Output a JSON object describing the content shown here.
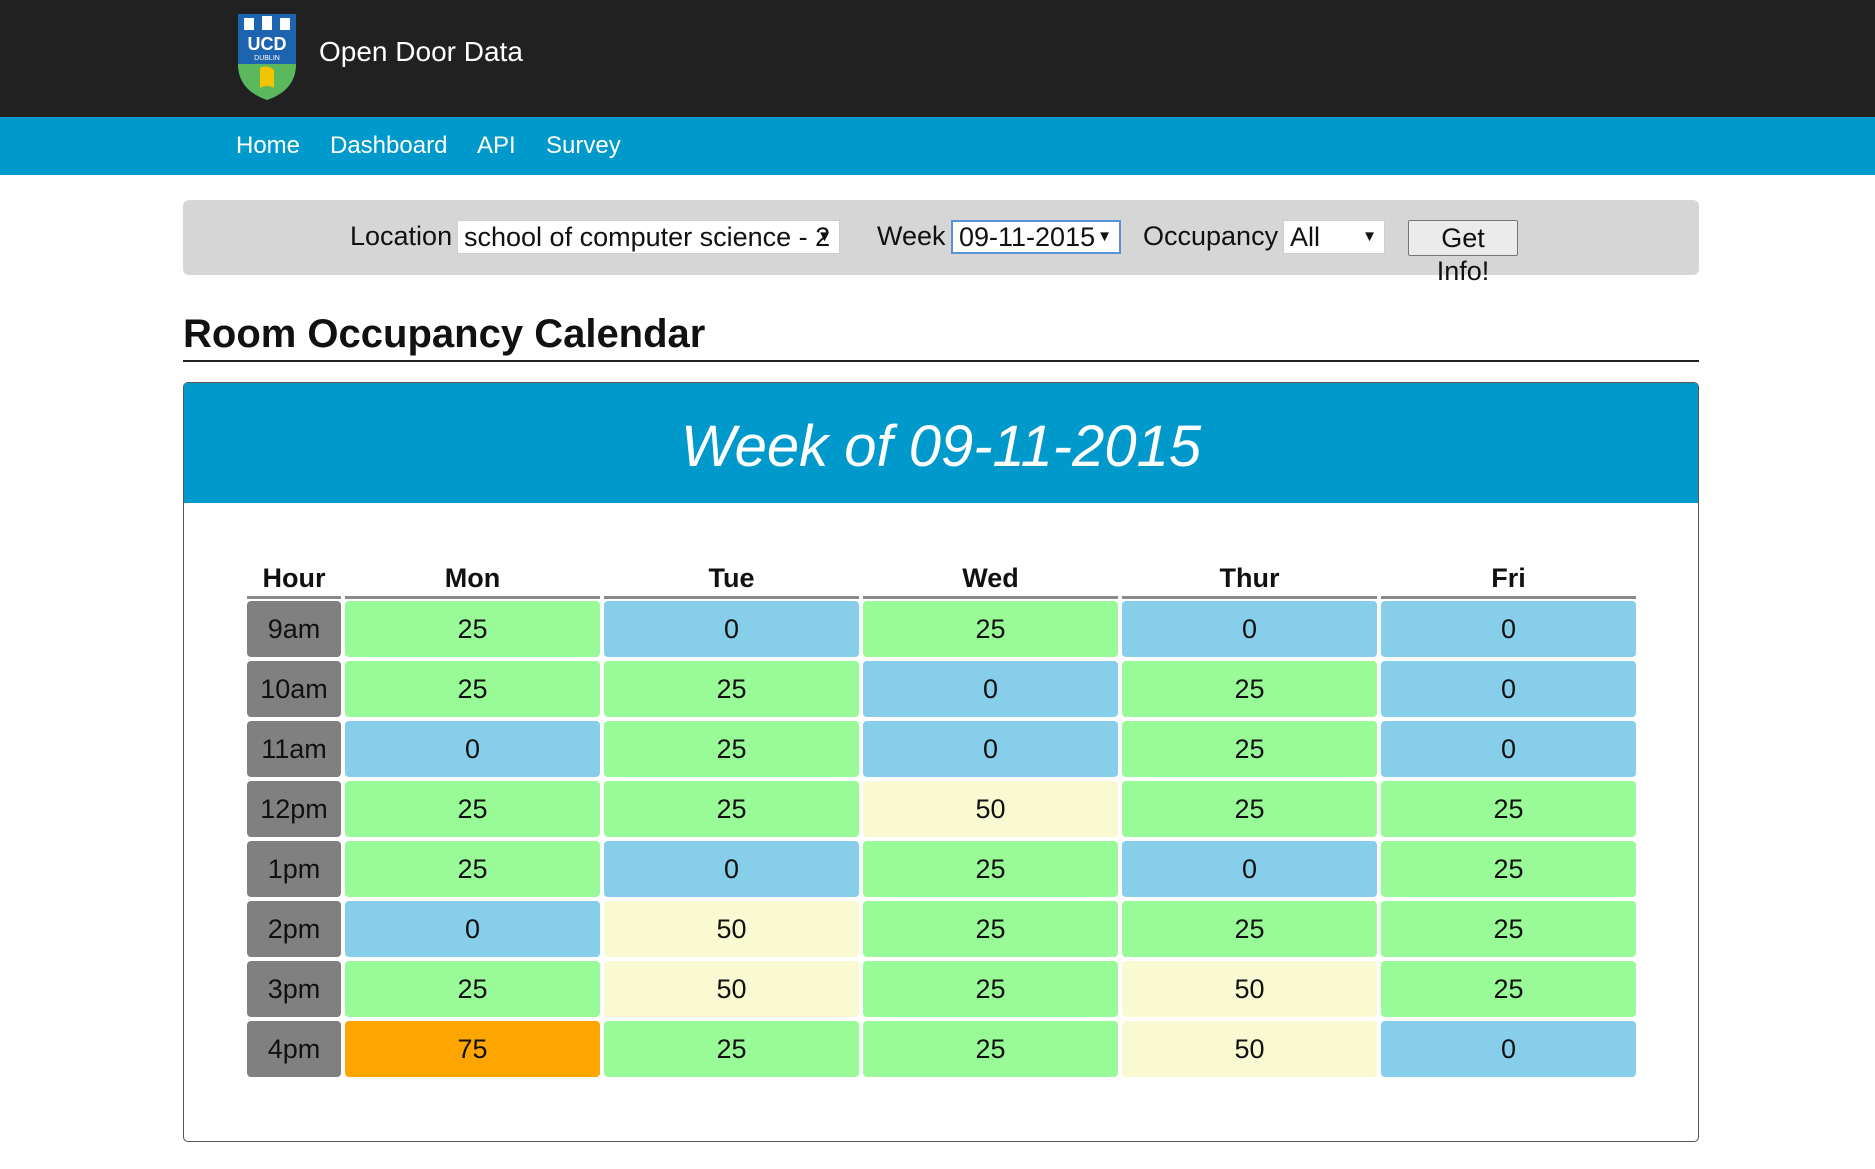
{
  "header": {
    "logo_text": "UCD",
    "logo_subtext": "DUBLIN",
    "site_title": "Open Door Data"
  },
  "nav": {
    "items": [
      "Home",
      "Dashboard",
      "API",
      "Survey"
    ]
  },
  "filters": {
    "location_label": "Location",
    "location_value": "school of computer science - 2",
    "week_label": "Week",
    "week_value": "09-11-2015",
    "occupancy_label": "Occupancy",
    "occupancy_value": "All",
    "submit_label": "Get Info!"
  },
  "page": {
    "title": "Room Occupancy Calendar"
  },
  "calendar": {
    "title": "Week of 09-11-2015",
    "hour_header": "Hour",
    "days": [
      "Mon",
      "Tue",
      "Wed",
      "Thur",
      "Fri"
    ],
    "hours": [
      "9am",
      "10am",
      "11am",
      "12pm",
      "1pm",
      "2pm",
      "3pm",
      "4pm"
    ],
    "values": [
      [
        25,
        0,
        25,
        0,
        0
      ],
      [
        25,
        25,
        0,
        25,
        0
      ],
      [
        0,
        25,
        0,
        25,
        0
      ],
      [
        25,
        25,
        50,
        25,
        25
      ],
      [
        25,
        0,
        25,
        0,
        25
      ],
      [
        0,
        50,
        25,
        25,
        25
      ],
      [
        25,
        50,
        25,
        50,
        25
      ],
      [
        75,
        25,
        25,
        50,
        0
      ]
    ],
    "colors": {
      "0": "#87ceeb",
      "25": "#98fb98",
      "50": "#fafad2",
      "75": "#ffa500",
      "hour_bg": "#808080"
    }
  }
}
